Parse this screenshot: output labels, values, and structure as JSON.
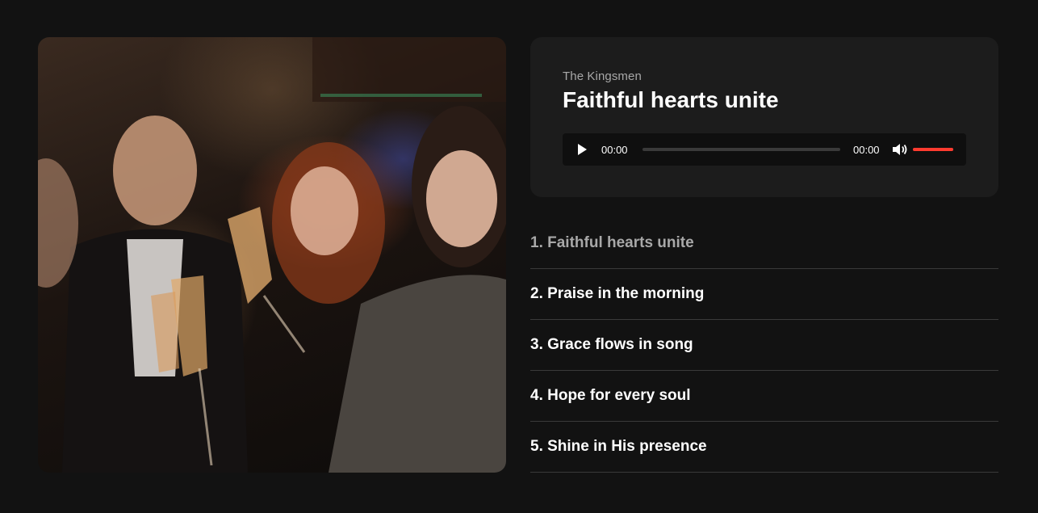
{
  "album": {
    "cover_alt": "Friends toasting with champagne glasses"
  },
  "player": {
    "artist": "The Kingsmen",
    "title": "Faithful hearts unite",
    "current_time": "00:00",
    "duration": "00:00",
    "progress": 0,
    "volume": 1,
    "accent_color": "#ff3b2f",
    "icons": {
      "play": "play-icon",
      "volume": "volume-icon"
    }
  },
  "playlist": {
    "active_index": 0,
    "tracks": [
      {
        "label": "1. Faithful hearts unite"
      },
      {
        "label": "2. Praise in the morning"
      },
      {
        "label": "3. Grace flows in song"
      },
      {
        "label": "4. Hope for every soul"
      },
      {
        "label": "5. Shine in His presence"
      }
    ]
  }
}
